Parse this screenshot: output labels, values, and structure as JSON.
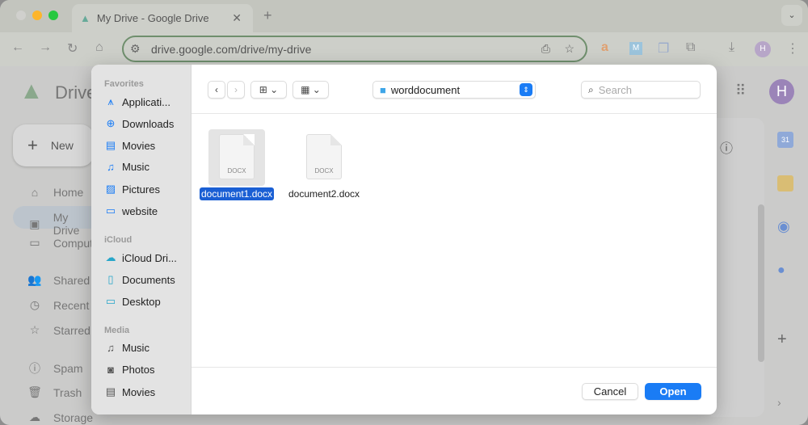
{
  "browser": {
    "tab_title": "My Drive - Google Drive",
    "url": "drive.google.com/drive/my-drive",
    "profile_initial": "H"
  },
  "drive": {
    "logo_text": "Drive",
    "new_label": "New",
    "nav": [
      "Home",
      "My Drive",
      "Computers",
      "Shared with me",
      "Recent",
      "Starred",
      "Spam",
      "Trash",
      "Storage"
    ],
    "nav_visible": [
      "Home",
      "My Drive",
      "Comput",
      "Shared",
      "Recent",
      "Starred",
      "Spam",
      "Trash",
      "Storage"
    ],
    "avatar": "H",
    "calendar_day": "31"
  },
  "dialog": {
    "sidebar": {
      "favorites_label": "Favorites",
      "favorites": [
        "Applicati...",
        "Downloads",
        "Movies",
        "Music",
        "Pictures",
        "website"
      ],
      "icloud_label": "iCloud",
      "icloud": [
        "iCloud Dri...",
        "Documents",
        "Desktop"
      ],
      "media_label": "Media",
      "media": [
        "Music",
        "Photos",
        "Movies"
      ]
    },
    "location": "worddocument",
    "search_placeholder": "Search",
    "files": [
      {
        "name": "document1.docx",
        "type": "DOCX",
        "selected": true
      },
      {
        "name": "document2.docx",
        "type": "DOCX",
        "selected": false
      }
    ],
    "cancel_label": "Cancel",
    "open_label": "Open",
    "accent": "#1a7cf5"
  }
}
